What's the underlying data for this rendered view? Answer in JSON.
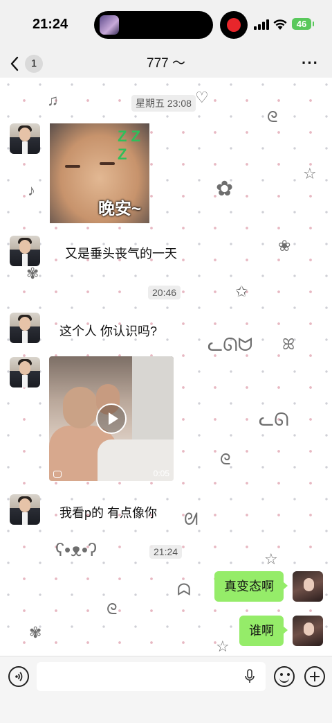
{
  "status_bar": {
    "time": "21:24",
    "battery": "46",
    "signal_icon": "signal-bars-icon",
    "wifi_icon": "wifi-icon",
    "recording_icon": "record-dot-icon",
    "recording_color": "#e8262b",
    "battery_color": "#59c85c"
  },
  "header": {
    "back_icon": "chevron-left-icon",
    "unread_count": "1",
    "title": "777 ～",
    "more_icon": "ellipsis-icon"
  },
  "messages": [
    {
      "type": "timestamp",
      "text": "星期五 23:08"
    },
    {
      "type": "sticker",
      "from": "contact",
      "caption": "晚安~",
      "sticker_text": "Z Z Z"
    },
    {
      "type": "text",
      "from": "contact",
      "text": "又是垂头丧气的一天"
    },
    {
      "type": "timestamp",
      "text": "20:46"
    },
    {
      "type": "text",
      "from": "contact",
      "text": "这个人 你认识吗?"
    },
    {
      "type": "video",
      "from": "contact",
      "duration": "0:05"
    },
    {
      "type": "text",
      "from": "contact",
      "text": "我看p的 有点像你"
    },
    {
      "type": "timestamp",
      "text": "21:24"
    },
    {
      "type": "text",
      "from": "me",
      "text": "真变态啊"
    },
    {
      "type": "text",
      "from": "me",
      "text": "谁啊"
    }
  ],
  "input_bar": {
    "voice_icon": "voice-input-icon",
    "mic_icon": "microphone-icon",
    "emoji_icon": "emoji-icon",
    "plus_icon": "plus-icon",
    "value": "",
    "placeholder": ""
  },
  "colors": {
    "my_bubble": "#95ec69",
    "header_bg": "#f1f1f1",
    "background": "#ffffff"
  }
}
